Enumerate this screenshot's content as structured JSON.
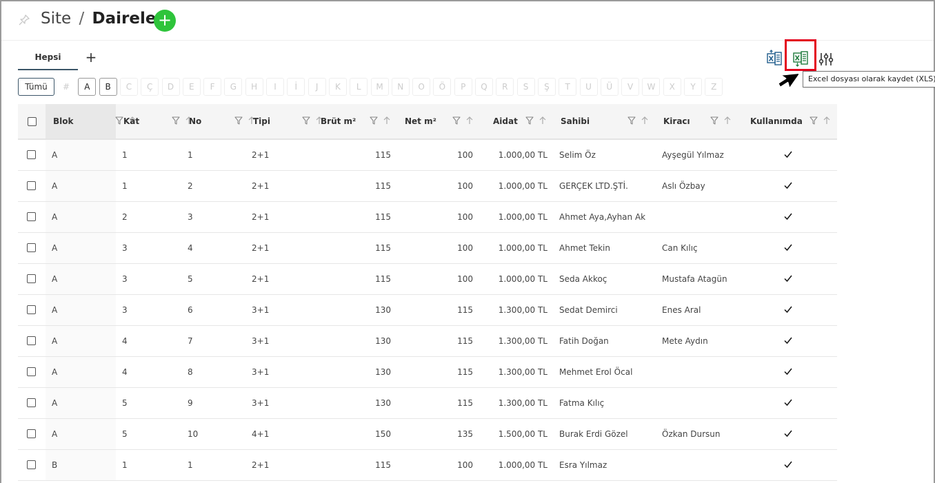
{
  "header": {
    "breadcrumb_parent": "Site",
    "breadcrumb_sep": "/",
    "title": "Daireler",
    "add_icon": "plus-icon",
    "add_label": "+"
  },
  "tabs": [
    {
      "label": "Hepsi",
      "active": true
    }
  ],
  "tab_add_label": "+",
  "toolbar": {
    "import_icon": "excel-import-icon",
    "export_icon": "excel-export-icon",
    "settings_icon": "column-settings-icon",
    "export_tooltip": "Excel dosyası olarak kaydet (XLS)"
  },
  "letters": {
    "all_label": "Tümü",
    "items": [
      "#",
      "A",
      "B",
      "C",
      "Ç",
      "D",
      "E",
      "F",
      "G",
      "H",
      "I",
      "İ",
      "J",
      "K",
      "L",
      "M",
      "N",
      "O",
      "Ö",
      "P",
      "Q",
      "R",
      "S",
      "Ş",
      "T",
      "U",
      "Ü",
      "V",
      "W",
      "X",
      "Y",
      "Z"
    ],
    "active": [
      "A",
      "B"
    ]
  },
  "columns": [
    "Blok",
    "Kat",
    "No",
    "Tipi",
    "Brüt m²",
    "Net m²",
    "Aidat",
    "Sahibi",
    "Kiracı",
    "Kullanımda"
  ],
  "rows": [
    {
      "blok": "A",
      "kat": "1",
      "no": "1",
      "tipi": "2+1",
      "brut": "115",
      "net": "100",
      "aidat": "1.000,00 TL",
      "sahibi": "Selim Öz",
      "kiraci": "Ayşegül Yılmaz",
      "kullanimda": true
    },
    {
      "blok": "A",
      "kat": "1",
      "no": "2",
      "tipi": "2+1",
      "brut": "115",
      "net": "100",
      "aidat": "1.000,00 TL",
      "sahibi": "GERÇEK LTD.ŞTİ.",
      "kiraci": "Aslı Özbay",
      "kullanimda": true
    },
    {
      "blok": "A",
      "kat": "2",
      "no": "3",
      "tipi": "2+1",
      "brut": "115",
      "net": "100",
      "aidat": "1.000,00 TL",
      "sahibi": "Ahmet Aya,Ayhan Ak",
      "kiraci": "",
      "kullanimda": true
    },
    {
      "blok": "A",
      "kat": "3",
      "no": "4",
      "tipi": "2+1",
      "brut": "115",
      "net": "100",
      "aidat": "1.000,00 TL",
      "sahibi": "Ahmet Tekin",
      "kiraci": "Can Kılıç",
      "kullanimda": true
    },
    {
      "blok": "A",
      "kat": "3",
      "no": "5",
      "tipi": "2+1",
      "brut": "115",
      "net": "100",
      "aidat": "1.000,00 TL",
      "sahibi": "Seda Akkoç",
      "kiraci": "Mustafa Atagün",
      "kullanimda": true
    },
    {
      "blok": "A",
      "kat": "3",
      "no": "6",
      "tipi": "3+1",
      "brut": "130",
      "net": "115",
      "aidat": "1.300,00 TL",
      "sahibi": "Sedat Demirci",
      "kiraci": "Enes Aral",
      "kullanimda": true
    },
    {
      "blok": "A",
      "kat": "4",
      "no": "7",
      "tipi": "3+1",
      "brut": "130",
      "net": "115",
      "aidat": "1.300,00 TL",
      "sahibi": "Fatih Doğan",
      "kiraci": "Mete Aydın",
      "kullanimda": true
    },
    {
      "blok": "A",
      "kat": "4",
      "no": "8",
      "tipi": "3+1",
      "brut": "130",
      "net": "115",
      "aidat": "1.300,00 TL",
      "sahibi": "Mehmet Erol Öcal",
      "kiraci": "",
      "kullanimda": true
    },
    {
      "blok": "A",
      "kat": "5",
      "no": "9",
      "tipi": "3+1",
      "brut": "130",
      "net": "115",
      "aidat": "1.300,00 TL",
      "sahibi": "Fatma Kılıç",
      "kiraci": "",
      "kullanimda": true
    },
    {
      "blok": "A",
      "kat": "5",
      "no": "10",
      "tipi": "4+1",
      "brut": "150",
      "net": "135",
      "aidat": "1.500,00 TL",
      "sahibi": "Burak Erdi Gözel",
      "kiraci": "Özkan Dursun",
      "kullanimda": true
    },
    {
      "blok": "B",
      "kat": "1",
      "no": "1",
      "tipi": "2+1",
      "brut": "115",
      "net": "100",
      "aidat": "1.000,00 TL",
      "sahibi": "Esra Yılmaz",
      "kiraci": "",
      "kullanimda": true
    }
  ],
  "colors": {
    "accent_green": "#2ec43b",
    "tab_underline": "#3b5568",
    "highlight_red": "#e3001b",
    "excel_blue": "#1f5c8c",
    "excel_green": "#1e7b3c"
  }
}
